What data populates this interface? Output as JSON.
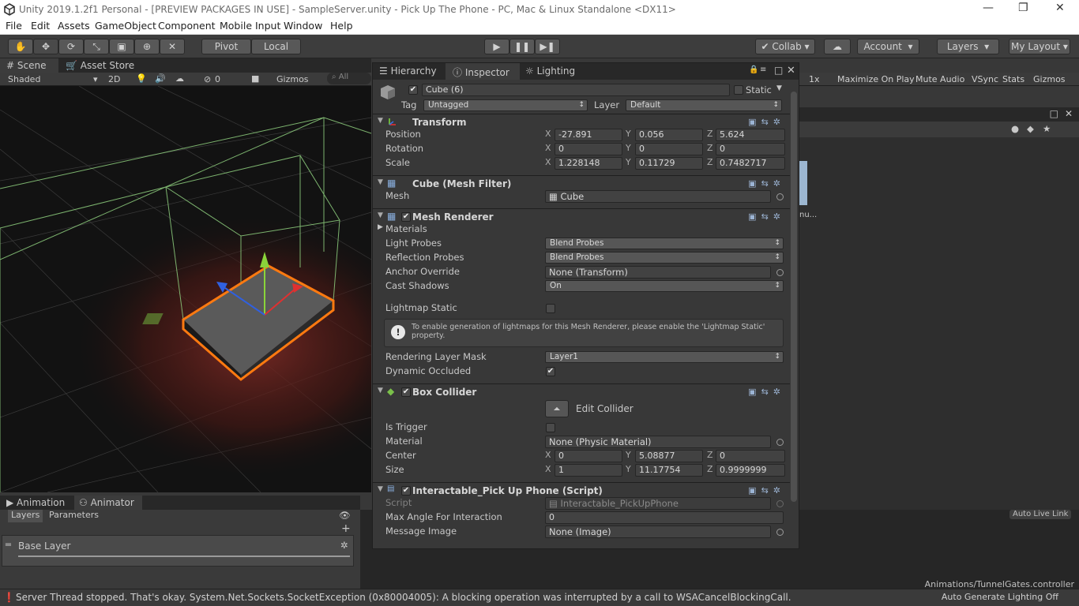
{
  "window": {
    "title": "Unity 2019.1.2f1 Personal - [PREVIEW PACKAGES IN USE] - SampleServer.unity - Pick Up The Phone - PC, Mac & Linux Standalone <DX11>",
    "minimize": "—",
    "maximize": "❐",
    "close": "✕"
  },
  "menu": [
    "File",
    "Edit",
    "Assets",
    "GameObject",
    "Component",
    "Mobile Input",
    "Window",
    "Help"
  ],
  "toolbar": {
    "pivot": "Pivot",
    "local": "Local",
    "collab": "Collab",
    "account": "Account",
    "layers": "Layers",
    "layout": "My Layout"
  },
  "scene": {
    "tabs": [
      "Scene",
      "Asset Store"
    ],
    "shading": "Shaded",
    "mode2d": "2D",
    "fx_count": "0",
    "gizmos": "Gizmos",
    "search_placeholder": "All"
  },
  "game_bar": {
    "scale": "1x",
    "maximize": "Maximize On Play",
    "mute": "Mute Audio",
    "vsync": "VSync",
    "stats": "Stats",
    "gizmos": "Gizmos"
  },
  "project": {
    "truncated_label": "nu..."
  },
  "inspector": {
    "tabs": [
      "Hierarchy",
      "Inspector",
      "Lighting"
    ],
    "object_name": "Cube (6)",
    "static_label": "Static",
    "tag_label": "Tag",
    "tag_value": "Untagged",
    "layer_label": "Layer",
    "layer_value": "Default",
    "transform": {
      "title": "Transform",
      "rows": [
        {
          "label": "Position",
          "x": "-27.891",
          "y": "0.056",
          "z": "5.624"
        },
        {
          "label": "Rotation",
          "x": "0",
          "y": "0",
          "z": "0"
        },
        {
          "label": "Scale",
          "x": "1.228148",
          "y": "0.11729",
          "z": "0.7482717"
        }
      ]
    },
    "mesh_filter": {
      "title": "Cube (Mesh Filter)",
      "mesh_label": "Mesh",
      "mesh_value": "Cube"
    },
    "mesh_renderer": {
      "title": "Mesh Renderer",
      "materials": "Materials",
      "light_probes_label": "Light Probes",
      "light_probes_value": "Blend Probes",
      "reflection_label": "Reflection Probes",
      "reflection_value": "Blend Probes",
      "anchor_label": "Anchor Override",
      "anchor_value": "None (Transform)",
      "shadows_label": "Cast Shadows",
      "shadows_value": "On",
      "lightmap_label": "Lightmap Static",
      "help_text": "To enable generation of lightmaps for this Mesh Renderer, please enable the 'Lightmap Static' property.",
      "rlm_label": "Rendering Layer Mask",
      "rlm_value": "Layer1",
      "occluded_label": "Dynamic Occluded"
    },
    "box_collider": {
      "title": "Box Collider",
      "edit": "Edit Collider",
      "trigger_label": "Is Trigger",
      "material_label": "Material",
      "material_value": "None (Physic Material)",
      "center_label": "Center",
      "center": {
        "x": "0",
        "y": "5.08877",
        "z": "0"
      },
      "size_label": "Size",
      "size": {
        "x": "1",
        "y": "11.17754",
        "z": "0.9999999"
      }
    },
    "script": {
      "title": "Interactable_Pick Up Phone (Script)",
      "script_label": "Script",
      "script_value": "Interactable_PickUpPhone",
      "angle_label": "Max Angle For Interaction",
      "angle_value": "0",
      "message_label": "Message Image",
      "message_value": "None (Image)"
    }
  },
  "animator": {
    "tabs": [
      "Animation",
      "Animator"
    ],
    "subtabs": [
      "Layers",
      "Parameters"
    ],
    "base_layer": "Base Layer",
    "path": "Animations/TunnelGates.controller",
    "live_link": "Auto Live Link"
  },
  "status": {
    "message": "Server Thread stopped. That's okay. System.Net.Sockets.SocketException (0x80004005): A blocking operation was interrupted by a call to WSACancelBlockingCall.",
    "lighting": "Auto Generate Lighting Off"
  }
}
